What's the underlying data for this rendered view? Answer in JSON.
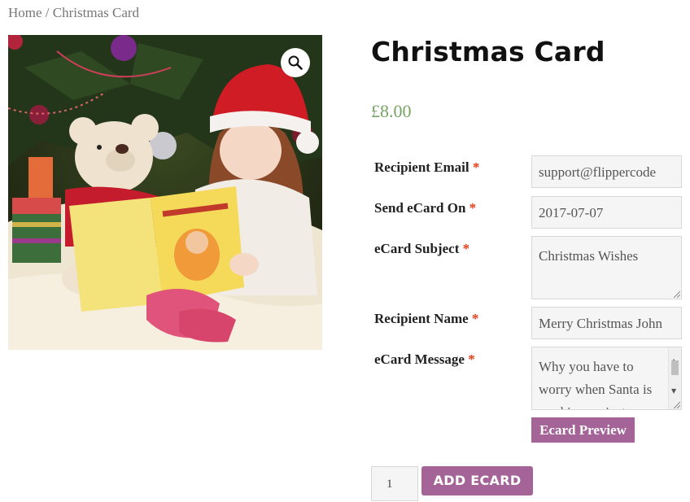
{
  "breadcrumb": {
    "home": "Home",
    "separator": " / ",
    "current": "Christmas Card"
  },
  "product": {
    "title": "Christmas Card",
    "price": "£8.00",
    "image_icon": "zoom-icon"
  },
  "form": {
    "required_mark": "*",
    "recipient_email": {
      "label": "Recipient Email",
      "value": "support@flippercode"
    },
    "send_on": {
      "label": "Send eCard On",
      "value": "2017-07-07"
    },
    "subject": {
      "label": "eCard Subject",
      "value": "Christmas Wishes"
    },
    "recipient_name": {
      "label": "Recipient Name",
      "value": "Merry Christmas John"
    },
    "message": {
      "label": "eCard Message",
      "value": "Why you have to worry when Santa is working on just..."
    },
    "preview_button": "Ecard Preview"
  },
  "cart": {
    "quantity": "1",
    "add_button": "ADD ECARD"
  },
  "colors": {
    "accent": "#a46497",
    "price": "#77a464",
    "required": "#e2401c"
  }
}
